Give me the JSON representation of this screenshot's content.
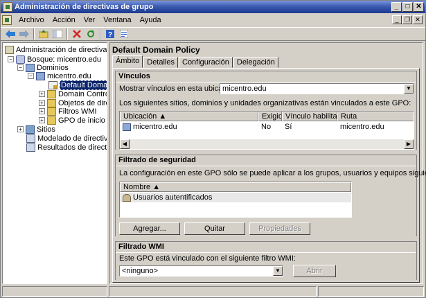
{
  "window": {
    "title": "Administración de directivas de grupo",
    "buttons": {
      "minimize": "_",
      "maximize": "□",
      "close": "✕"
    }
  },
  "menu": {
    "items": [
      "Archivo",
      "Acción",
      "Ver",
      "Ventana",
      "Ayuda"
    ],
    "mdi_buttons": {
      "minimize": "_",
      "restore": "❐",
      "close": "✕"
    }
  },
  "toolbar": {
    "icons": [
      "back-icon",
      "forward-icon",
      "up-folder-icon",
      "show-tree-icon",
      "delete-icon",
      "refresh-icon",
      "help-icon",
      "properties-icon"
    ]
  },
  "tree": {
    "root": "Administración de directivas de gr",
    "forest": "Bosque: micentro.edu",
    "domains": "Dominios",
    "domain": "micentro.edu",
    "selected": "Default Domain Po",
    "children": [
      "Domain Controller",
      "Objetos de direct",
      "Filtros WMI",
      "GPO de inicio"
    ],
    "sites": "Sitios",
    "modeling": "Modelado de directivas de",
    "results": "Resultados de directivas d"
  },
  "gpo": {
    "title": "Default Domain Policy",
    "tabs": [
      "Ámbito",
      "Detalles",
      "Configuración",
      "Delegación"
    ]
  },
  "links": {
    "header": "Vínculos",
    "location_label": "Mostrar vínculos en esta ubicación:",
    "location_value": "micentro.edu",
    "description": "Los siguientes sitios, dominios y unidades organizativas están vinculados a este GPO:",
    "columns": [
      "Ubicación",
      "Exigida",
      "Vínculo habilitado",
      "Ruta"
    ],
    "rows": [
      {
        "location": "micentro.edu",
        "enforced": "No",
        "enabled": "Sí",
        "path": "micentro.edu"
      }
    ]
  },
  "security": {
    "header": "Filtrado de seguridad",
    "description": "La configuración en este GPO sólo se puede aplicar a los grupos, usuarios y equipos siguientes:",
    "columns": [
      "Nombre"
    ],
    "rows": [
      "Usuarios autentificados"
    ],
    "buttons": {
      "add": "Agregar...",
      "remove": "Quitar",
      "properties": "Propiedades"
    }
  },
  "wmi": {
    "header": "Filtrado WMI",
    "description": "Este GPO está vinculado con el siguiente filtro WMI:",
    "value": "<ninguno>",
    "open_button": "Abrir"
  }
}
